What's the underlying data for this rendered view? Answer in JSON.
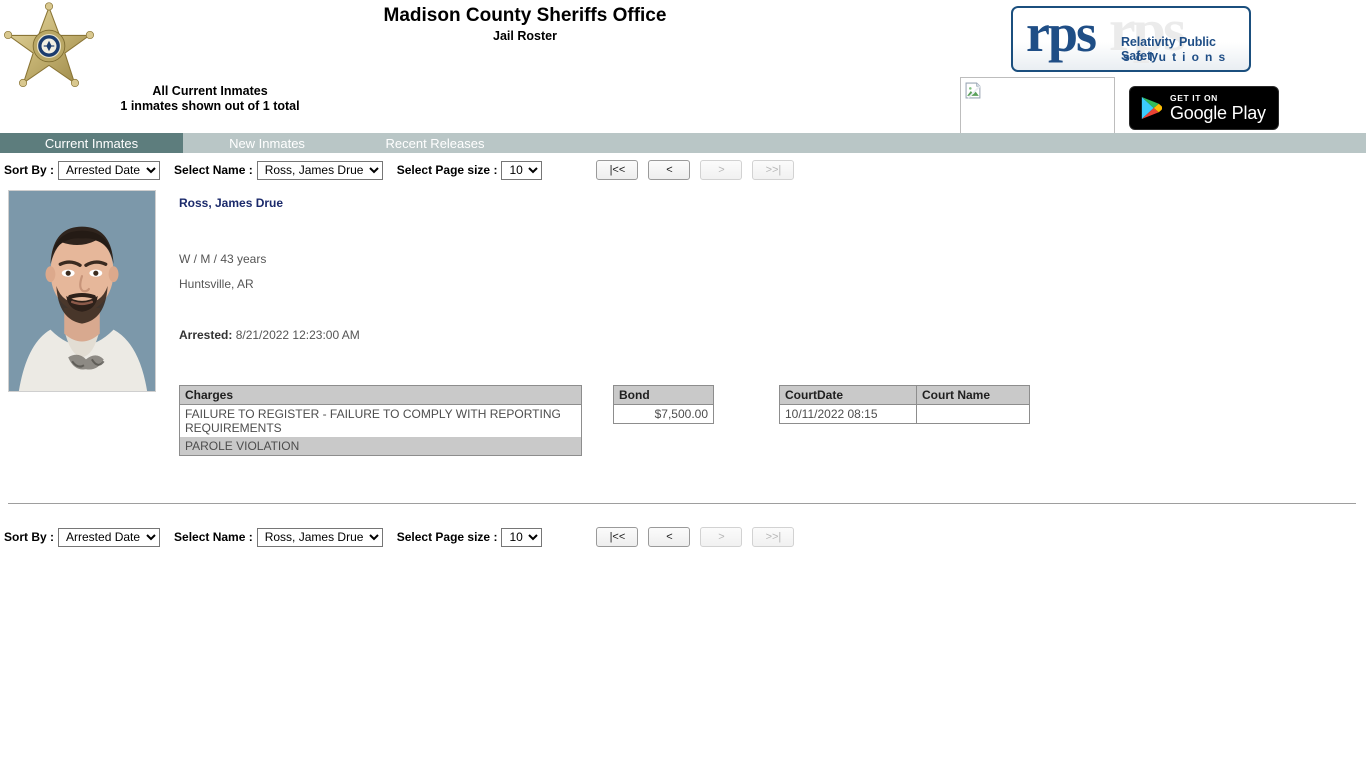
{
  "header": {
    "agency_title": "Madison County Sheriffs Office",
    "roster_subtitle": "Jail Roster",
    "count_line1": "All Current Inmates",
    "count_line2": "1 inmates shown out of 1 total",
    "star_badge_icon": "sheriff-star-badge-icon",
    "rps_logo": {
      "mark": "rps",
      "tagline_line1": "Relativity Public Safety",
      "tagline_line2": "solutions",
      "ghost_text": "rps"
    },
    "broken_image_alt": "broken-image-placeholder",
    "google_play": {
      "small_text": "GET IT ON",
      "large_text": "Google Play",
      "icon": "google-play-triangle-icon"
    }
  },
  "tabs": [
    {
      "label": "Current Inmates",
      "active": true
    },
    {
      "label": "New Inmates",
      "active": false
    },
    {
      "label": "Recent Releases",
      "active": false
    }
  ],
  "controls": {
    "sort_by_label": "Sort By :",
    "sort_by_value": "Arrested Date",
    "sort_by_options": [
      "Arrested Date"
    ],
    "select_name_label": "Select Name :",
    "select_name_value": "Ross, James Drue",
    "select_name_options": [
      "Ross, James Drue"
    ],
    "page_size_label": "Select Page size :",
    "page_size_value": "10",
    "page_size_options": [
      "10"
    ],
    "pagination": {
      "first_label": "|<<",
      "prev_label": "<",
      "next_label": ">",
      "last_label": ">>|",
      "first_enabled": true,
      "prev_enabled": true,
      "next_enabled": false,
      "last_enabled": false
    }
  },
  "inmate": {
    "name": "Ross, James Drue",
    "demographics": "W / M / 43 years",
    "city_state": "Huntsville, AR",
    "arrested_label": "Arrested:",
    "arrested_value": "8/21/2022 12:23:00 AM",
    "mugshot_alt": "inmate-mugshot-photo",
    "charges": {
      "header": "Charges",
      "rows": [
        "FAILURE TO REGISTER - FAILURE TO COMPLY WITH REPORTING REQUIREMENTS",
        "PAROLE VIOLATION"
      ]
    },
    "bond": {
      "header": "Bond",
      "rows": [
        "$7,500.00"
      ]
    },
    "court": {
      "headers": [
        "CourtDate",
        "Court Name"
      ],
      "rows": [
        {
          "date": "10/11/2022 08:15",
          "name": ""
        }
      ]
    }
  },
  "colors": {
    "tab_active_bg": "#5d7d7d",
    "tab_bar_bg": "#b9c6c6",
    "table_header_bg": "#c9c9c9",
    "name_link": "#1b2a6b",
    "rps_blue": "#1f4e86"
  }
}
